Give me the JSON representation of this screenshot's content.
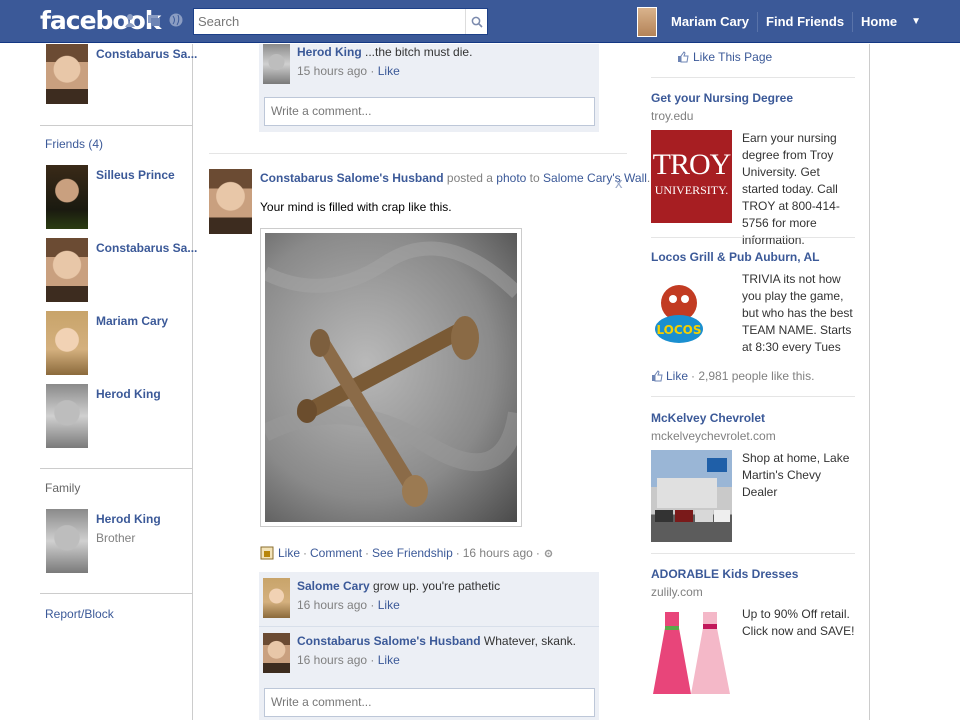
{
  "topbar": {
    "logo": "facebook",
    "search_placeholder": "Search",
    "user_name": "Mariam Cary",
    "find_friends": "Find Friends",
    "home": "Home",
    "caret": "▼",
    "bg_color": "#3b5998"
  },
  "left": {
    "top_friend": "Constabarus Sa...",
    "friends_title": "Friends (4)",
    "friends": [
      {
        "name": "Silleus Prince"
      },
      {
        "name": "Constabarus Sa..."
      },
      {
        "name": "Mariam Cary"
      },
      {
        "name": "Herod King"
      }
    ],
    "family_title": "Family",
    "family": [
      {
        "name": "Herod King",
        "relation": "Brother"
      }
    ],
    "report": "Report/Block"
  },
  "feed": {
    "top_comment": {
      "author": "Herod King",
      "text": "...the bitch must die.",
      "time": "15 hours ago",
      "like": "Like"
    },
    "write_placeholder": "Write a comment...",
    "post": {
      "author": "Constabarus Salome's Husband",
      "verb": "posted a",
      "photo": "photo",
      "to": "to",
      "target": "Salome Cary's Wall",
      "period": ".",
      "message": "Your mind is filled with crap like this.",
      "close": "x",
      "actions": {
        "like": "Like",
        "comment": "Comment",
        "friendship": "See Friendship",
        "time": "16 hours ago",
        "dot": "·"
      }
    },
    "comments": [
      {
        "author": "Salome Cary",
        "text": "grow up. you're pathetic",
        "time": "16 hours ago",
        "like": "Like"
      },
      {
        "author": "Constabarus Salome's Husband",
        "text": "Whatever, skank.",
        "time": "16 hours ago",
        "like": "Like"
      }
    ]
  },
  "ads": {
    "like_page": "Like This Page",
    "items": [
      {
        "title": "Get your Nursing Degree",
        "url": "troy.edu",
        "body": "Earn your nursing degree from Troy University. Get started today. Call TROY at 800-414-5756 for more information.",
        "img_text1": "TROY",
        "img_text2": "UNIVERSITY."
      },
      {
        "title": "Locos Grill & Pub Auburn, AL",
        "body": "TRIVIA its not how you play the game, but who has the best TEAM NAME. Starts at 8:30 every Tues",
        "like": "Like",
        "like_count": "· 2,981 people like this.",
        "img_text": "LOCOS"
      },
      {
        "title": "McKelvey Chevrolet",
        "url": "mckelveychevrolet.com",
        "body": "Shop at home, Lake Martin's Chevy Dealer"
      },
      {
        "title": "ADORABLE Kids Dresses",
        "url": "zulily.com",
        "body": "Up to 90% Off retail. Click now and SAVE!"
      }
    ]
  }
}
